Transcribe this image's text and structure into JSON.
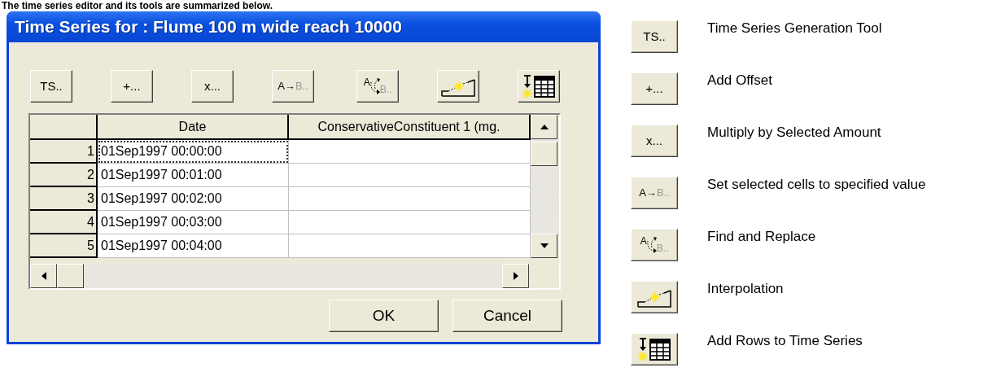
{
  "heading": "The time series editor and its tools are summarized below.",
  "window": {
    "title": "Time Series for : Flume 100 m wide reach 10000"
  },
  "toolbar": [
    {
      "kind": "text",
      "label": "TS.."
    },
    {
      "kind": "text",
      "label": "+..."
    },
    {
      "kind": "text",
      "label": "x..."
    },
    {
      "kind": "set",
      "label": "A→",
      "label2": "B.."
    },
    {
      "kind": "find",
      "label": "A",
      "label2": "B.."
    },
    {
      "kind": "interp"
    },
    {
      "kind": "addrows"
    }
  ],
  "table": {
    "columns": [
      "Date",
      "ConservativeConstituent 1 (mg."
    ],
    "rows": [
      {
        "number": "1",
        "date": "01Sep1997 00:00:00",
        "focused": true
      },
      {
        "number": "2",
        "date": "01Sep1997 00:01:00",
        "focused": false
      },
      {
        "number": "3",
        "date": "01Sep1997 00:02:00",
        "focused": false
      },
      {
        "number": "4",
        "date": "01Sep1997 00:03:00",
        "focused": false
      },
      {
        "number": "5",
        "date": "01Sep1997 00:04:00",
        "focused": false
      }
    ]
  },
  "buttons": [
    "OK",
    "Cancel"
  ],
  "legend": [
    {
      "tool": {
        "kind": "text",
        "label": "TS.."
      },
      "description": "Time Series Generation Tool"
    },
    {
      "tool": {
        "kind": "text",
        "label": "+..."
      },
      "description": "Add Offset"
    },
    {
      "tool": {
        "kind": "text",
        "label": "x..."
      },
      "description": "Multiply by Selected Amount"
    },
    {
      "tool": {
        "kind": "set",
        "label": "A→",
        "label2": "B.."
      },
      "description": "Set selected cells to specified value"
    },
    {
      "tool": {
        "kind": "find",
        "label": "A",
        "label2": "B.."
      },
      "description": "Find and Replace"
    },
    {
      "tool": {
        "kind": "interp"
      },
      "description": "Interpolation"
    },
    {
      "tool": {
        "kind": "addrows"
      },
      "description": "Add Rows to Time Series"
    }
  ]
}
